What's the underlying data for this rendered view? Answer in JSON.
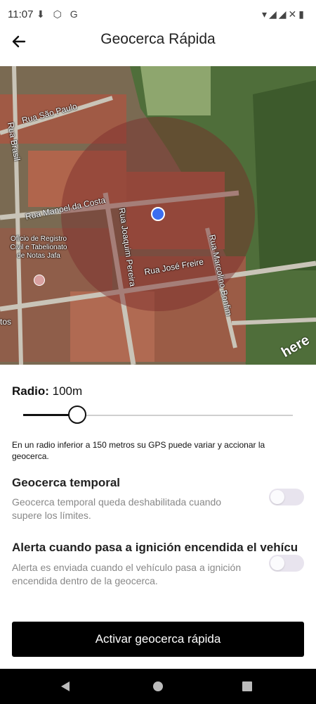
{
  "status": {
    "time": "11:07",
    "notif_icons": "⬇ ⬡ G",
    "right_icons": "▾◢◢✕▮"
  },
  "appbar": {
    "title": "Geocerca Rápida"
  },
  "map": {
    "streets": [
      "Rua São Paulo",
      "Rua Brasil",
      "Rua Manoel da Costa",
      "Rua Joaquim Pereira",
      "Rua José Freire",
      "Rua Marcolino Bonfim",
      "tos"
    ],
    "poi": "Ofício de Registro Civil e Tabelionato de Notas Jafa",
    "logo": "here",
    "geofence_color": "#7a2a2a",
    "marker_color": "#3b6ef0"
  },
  "radius": {
    "label": "Radio:",
    "value": "100m",
    "slider_fraction": 0.2,
    "note": "En un radio inferior a 150 metros su GPS puede variar y accionar la geocerca."
  },
  "options": [
    {
      "title": "Geocerca temporal",
      "desc": "Geocerca temporal queda deshabilitada cuando supere los límites.",
      "enabled": false
    },
    {
      "title": "Alerta cuando pasa a ignición encendida el vehícu",
      "desc": "Alerta es enviada cuando el vehículo pasa a ignición encendida dentro de la geocerca.",
      "enabled": false
    }
  ],
  "cta": {
    "label": "Activar geocerca rápida"
  }
}
